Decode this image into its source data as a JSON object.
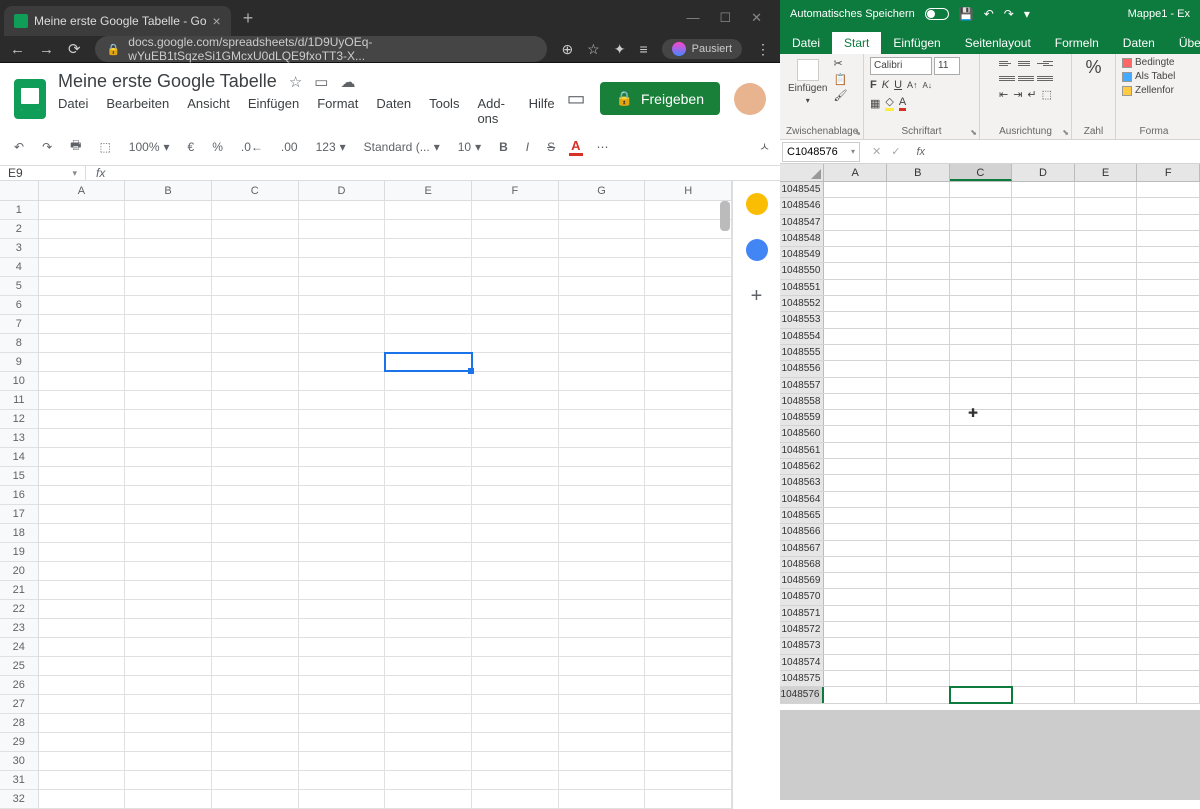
{
  "chrome": {
    "tab_title": "Meine erste Google Tabelle - Go",
    "url": "docs.google.com/spreadsheets/d/1D9UyOEq-wYuEB1tSqzeSi1GMcxU0dLQE9fxoTT3-X...",
    "pause_label": "Pausiert"
  },
  "gsheets": {
    "title": "Meine erste Google Tabelle",
    "menu": [
      "Datei",
      "Bearbeiten",
      "Ansicht",
      "Einfügen",
      "Format",
      "Daten",
      "Tools",
      "Add-ons",
      "Hilfe"
    ],
    "share_label": "Freigeben",
    "toolbar": {
      "zoom": "100%",
      "currency": "€",
      "percent": "%",
      "dec_dec": ".0",
      "dec_inc": ".00",
      "format_num": "123",
      "font": "Standard (...",
      "font_size": "10",
      "more": "⋯"
    },
    "name_box": "E9",
    "columns": [
      "A",
      "B",
      "C",
      "D",
      "E",
      "F",
      "G",
      "H"
    ],
    "row_count": 32,
    "selected": {
      "row": 9,
      "col": "E"
    }
  },
  "excel": {
    "autosave_label": "Automatisches Speichern",
    "title": "Mappe1  -  Ex",
    "tabs": [
      "Datei",
      "Start",
      "Einfügen",
      "Seitenlayout",
      "Formeln",
      "Daten",
      "Überprüfen"
    ],
    "active_tab": "Start",
    "ribbon": {
      "paste": "Einfügen",
      "clipboard": "Zwischenablage",
      "font_name": "Calibri",
      "font_size": "11",
      "font_group": "Schriftart",
      "align_group": "Ausrichtung",
      "number": "Zahl",
      "percent": "%",
      "cond_format": "Bedingte",
      "as_table": "Als Tabel",
      "cell_format": "Zellenfor",
      "format_group": "Forma"
    },
    "name_box": "C1048576",
    "columns": [
      "A",
      "B",
      "C",
      "D",
      "E",
      "F"
    ],
    "row_start": 1048545,
    "row_end": 1048576,
    "selected_col": "C",
    "selected_row": 1048576
  }
}
